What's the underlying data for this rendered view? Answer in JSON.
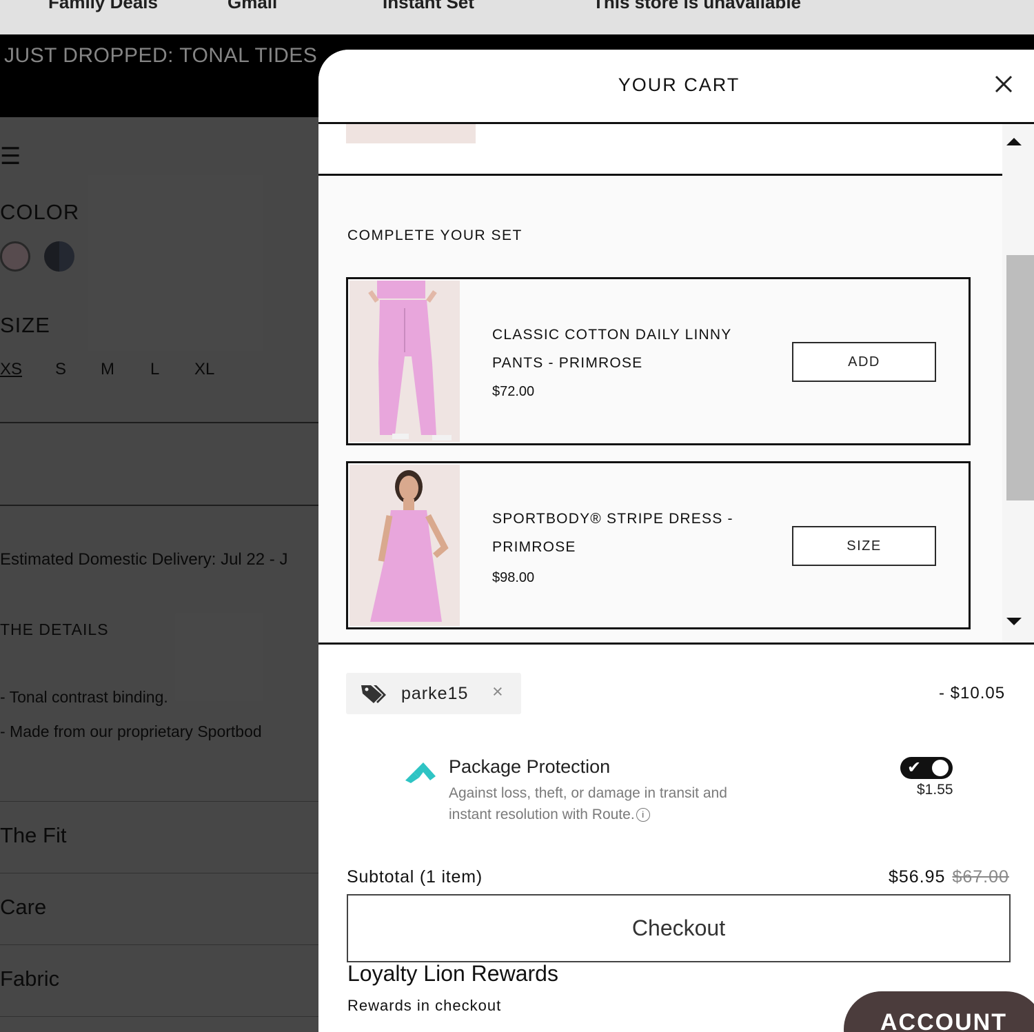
{
  "browser": {
    "bookmarks": [
      "Family Deals",
      "Gmail",
      "Instant Set",
      "This store is unavailable"
    ]
  },
  "announcement": {
    "text": "JUST DROPPED: TONAL TIDES"
  },
  "product": {
    "color_label": "COLOR",
    "size_label": "SIZE",
    "sizes": [
      "XS",
      "S",
      "M",
      "L",
      "XL"
    ],
    "delivery": "Estimated Domestic Delivery: Jul 22 - J",
    "details_heading": "THE DETAILS",
    "details": [
      "- Tonal contrast binding.",
      "- Made from our proprietary Sportbod"
    ],
    "accordions": [
      "The Fit",
      "Care",
      "Fabric"
    ]
  },
  "cart": {
    "title": "YOUR CART",
    "complete_set_heading": "COMPLETE YOUR SET",
    "upsells": [
      {
        "name": "CLASSIC COTTON DAILY LINNY PANTS - PRIMROSE",
        "price": "$72.00",
        "button": "ADD"
      },
      {
        "name": "SPORTBODY® STRIPE DRESS - PRIMROSE",
        "price": "$98.00",
        "button": "SIZE"
      }
    ],
    "discount": {
      "code": "parke15",
      "remove": "×",
      "amount": "- $10.05"
    },
    "package_protection": {
      "title": "Package Protection",
      "description": "Against loss, theft, or damage in transit and instant resolution with Route.",
      "info": "i",
      "price": "$1.55",
      "enabled": true
    },
    "subtotal": {
      "label": "Subtotal (1 item)",
      "price": "$56.95",
      "compare_price": "$67.00"
    },
    "checkout_label": "Checkout",
    "loyalty": {
      "title": "Loyalty Lion Rewards",
      "subtitle": "Rewards in checkout",
      "button": "ACCOUNT"
    }
  },
  "colors": {
    "page_bg": "#4a4a4a",
    "announcement_bg": "#000000",
    "toggle_on": "#111111",
    "route_teal": "#2ec4c4",
    "account_button": "#4b3c3c",
    "upsell_product": "#e8a6dc"
  },
  "icons": [
    "close-icon",
    "tag-icon",
    "route-logo-icon",
    "info-icon",
    "check-icon",
    "hamburger-icon",
    "scroll-up-icon",
    "scroll-down-icon"
  ]
}
